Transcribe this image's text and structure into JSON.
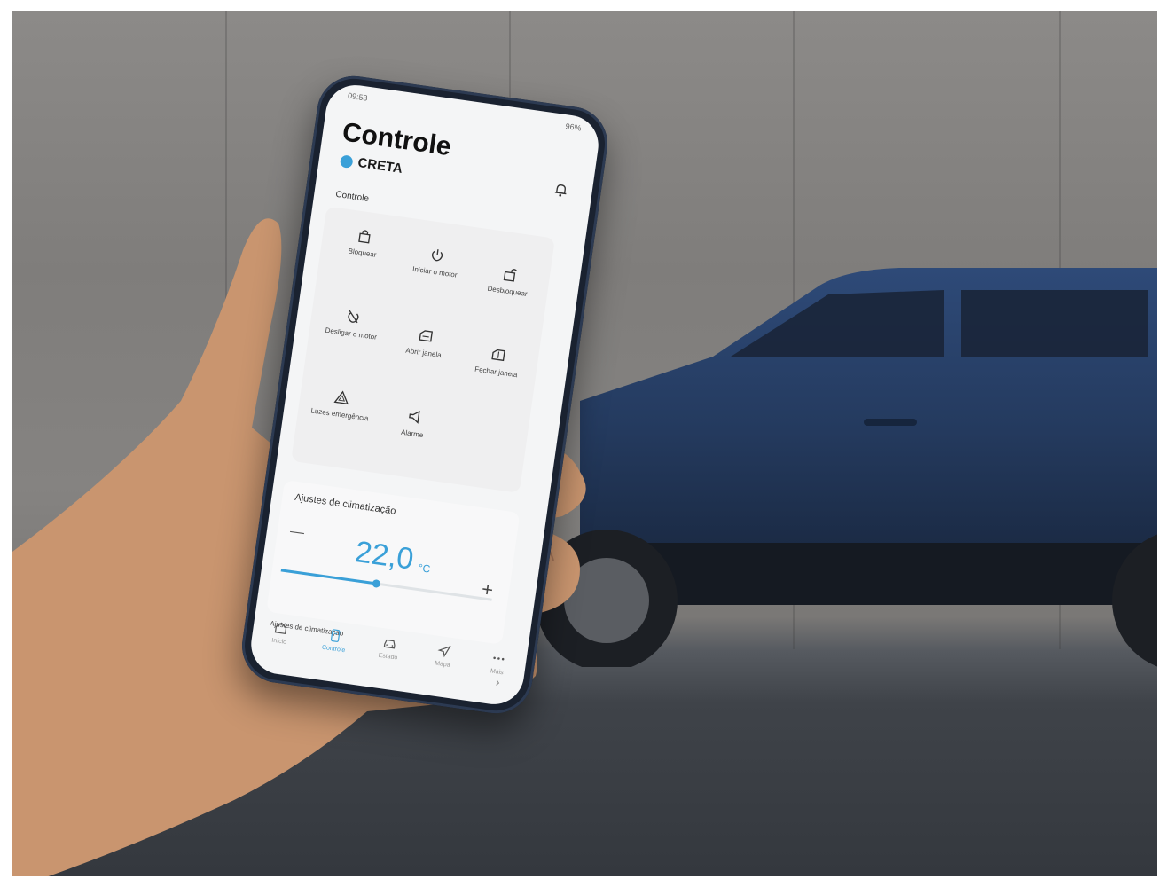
{
  "status": {
    "time": "09:53",
    "battery": "96%"
  },
  "header": {
    "title": "Controle",
    "vehicle": "CRETA"
  },
  "controls": {
    "section_label": "Controle",
    "items": [
      {
        "label": "Bloquear",
        "icon": "lock-icon"
      },
      {
        "label": "Iniciar o motor",
        "icon": "power-icon"
      },
      {
        "label": "Desbloquear",
        "icon": "unlock-icon"
      },
      {
        "label": "Desligar o motor",
        "icon": "power-off-icon"
      },
      {
        "label": "Abrir janela",
        "icon": "window-open-icon"
      },
      {
        "label": "Fechar janela",
        "icon": "window-close-icon"
      },
      {
        "label": "Luzes emergência",
        "icon": "hazard-icon"
      },
      {
        "label": "Alarme",
        "icon": "horn-icon"
      }
    ]
  },
  "climate": {
    "title": "Ajustes de climatização",
    "minus": "—",
    "temperature": "22,0",
    "unit": "°C",
    "plus": "+",
    "level": 0.45
  },
  "climate_sub": {
    "label": "Ajustes de climatização",
    "chevron": "›"
  },
  "nav": [
    {
      "label": "Início",
      "icon": "home-icon",
      "active": false
    },
    {
      "label": "Controle",
      "icon": "remote-icon",
      "active": true
    },
    {
      "label": "Estado",
      "icon": "car-icon",
      "active": false
    },
    {
      "label": "Mapa",
      "icon": "navigate-icon",
      "active": false
    },
    {
      "label": "Mais",
      "icon": "more-icon",
      "active": false
    }
  ],
  "colors": {
    "accent": "#3aa0d8",
    "car_body": "#243a5e",
    "wall": "#8c8a88",
    "road": "#3a3e44"
  }
}
